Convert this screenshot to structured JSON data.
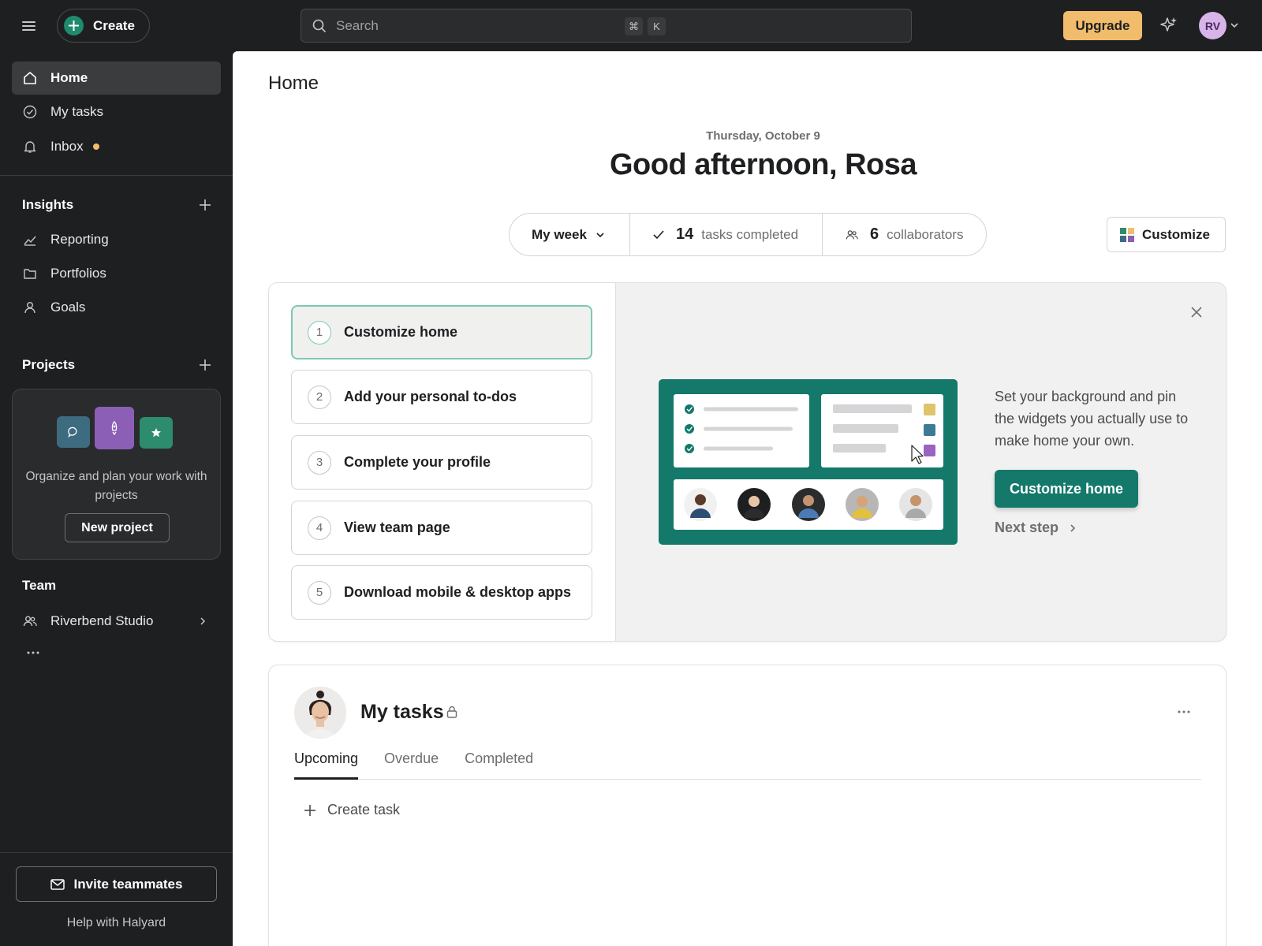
{
  "topbar": {
    "create_label": "Create",
    "search_placeholder": "Search",
    "shortcut_keys": [
      "⌘",
      "K"
    ],
    "upgrade_label": "Upgrade",
    "avatar_initials": "RV"
  },
  "sidebar": {
    "nav": [
      {
        "label": "Home",
        "icon": "home-icon",
        "active": true
      },
      {
        "label": "My tasks",
        "icon": "check-circle-icon"
      },
      {
        "label": "Inbox",
        "icon": "bell-icon",
        "unread": true
      }
    ],
    "insights": {
      "heading": "Insights",
      "items": [
        {
          "label": "Reporting",
          "icon": "chart-line-icon"
        },
        {
          "label": "Portfolios",
          "icon": "folder-icon"
        },
        {
          "label": "Goals",
          "icon": "person-icon"
        }
      ]
    },
    "projects": {
      "heading": "Projects",
      "empty_text": "Organize and plan your work with projects",
      "new_project_label": "New project"
    },
    "team": {
      "heading": "Team",
      "items": [
        {
          "label": "Riverbend Studio",
          "icon": "people-icon"
        }
      ]
    },
    "invite_label": "Invite teammates",
    "help_label": "Help with Halyard"
  },
  "main": {
    "title": "Home",
    "date": "Thursday, October 9",
    "greeting": "Good afternoon, Rosa",
    "stats": {
      "period": "My week",
      "tasks_completed_count": "14",
      "tasks_completed_label": "tasks completed",
      "collaborators_count": "6",
      "collaborators_label": "collaborators"
    },
    "customize_label": "Customize",
    "onboarding": {
      "steps": [
        {
          "num": "1",
          "label": "Customize home",
          "active": true
        },
        {
          "num": "2",
          "label": "Add your personal to-dos"
        },
        {
          "num": "3",
          "label": "Complete your profile"
        },
        {
          "num": "4",
          "label": "View team page"
        },
        {
          "num": "5",
          "label": "Download mobile & desktop apps"
        }
      ],
      "description": "Set your background and pin the widgets you actually use to make home your own.",
      "cta_label": "Customize home",
      "next_label": "Next step"
    },
    "my_tasks": {
      "title": "My tasks",
      "tabs": [
        "Upcoming",
        "Overdue",
        "Completed"
      ],
      "active_tab": "Upcoming",
      "create_task_label": "Create task"
    }
  },
  "colors": {
    "brand_green": "#14796a",
    "upgrade_yellow": "#f1bd6c",
    "sidebar_bg": "#1e1f21",
    "avatar_purple": "#d8b4e8"
  }
}
